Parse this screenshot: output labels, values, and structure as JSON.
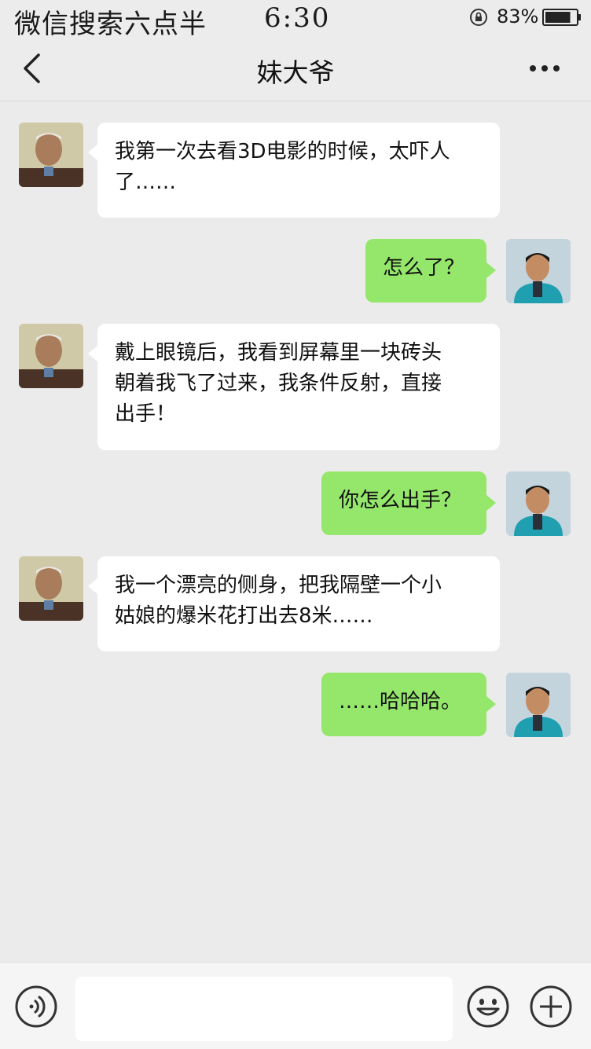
{
  "status_bar": {
    "carrier": "微信搜索六点半",
    "time": "6:30",
    "battery_percent": "83%",
    "battery_level": 0.83,
    "icons": [
      "rotation-lock-icon",
      "battery-icon"
    ]
  },
  "nav": {
    "title": "妹大爷",
    "icons": [
      "chevron-left-icon",
      "more-dots-icon"
    ]
  },
  "messages": [
    {
      "sender": "old-man",
      "direction": "incoming",
      "lines": [
        "我第一次去看3D电影的时候，太吓人",
        "了……"
      ]
    },
    {
      "sender": "young-man",
      "direction": "outgoing",
      "lines": [
        "怎么了？"
      ]
    },
    {
      "sender": "old-man",
      "direction": "incoming",
      "lines": [
        "戴上眼镜后，我看到屏幕里一块砖头",
        "朝着我飞了过来，我条件反射，直接",
        "出手！"
      ]
    },
    {
      "sender": "young-man",
      "direction": "outgoing",
      "lines": [
        "你怎么出手？"
      ]
    },
    {
      "sender": "old-man",
      "direction": "incoming",
      "lines": [
        "我一个漂亮的侧身，把我隔壁一个小",
        "姑娘的爆米花打出去8米……"
      ]
    },
    {
      "sender": "young-man",
      "direction": "outgoing",
      "lines": [
        "……哈哈哈。"
      ]
    }
  ],
  "input_bar": {
    "text_value": "",
    "icons": [
      "voice-icon",
      "emoji-icon",
      "plus-icon"
    ]
  },
  "colors": {
    "background": "#ebebeb",
    "incoming_bubble": "#ffffff",
    "outgoing_bubble": "#95e76c"
  }
}
